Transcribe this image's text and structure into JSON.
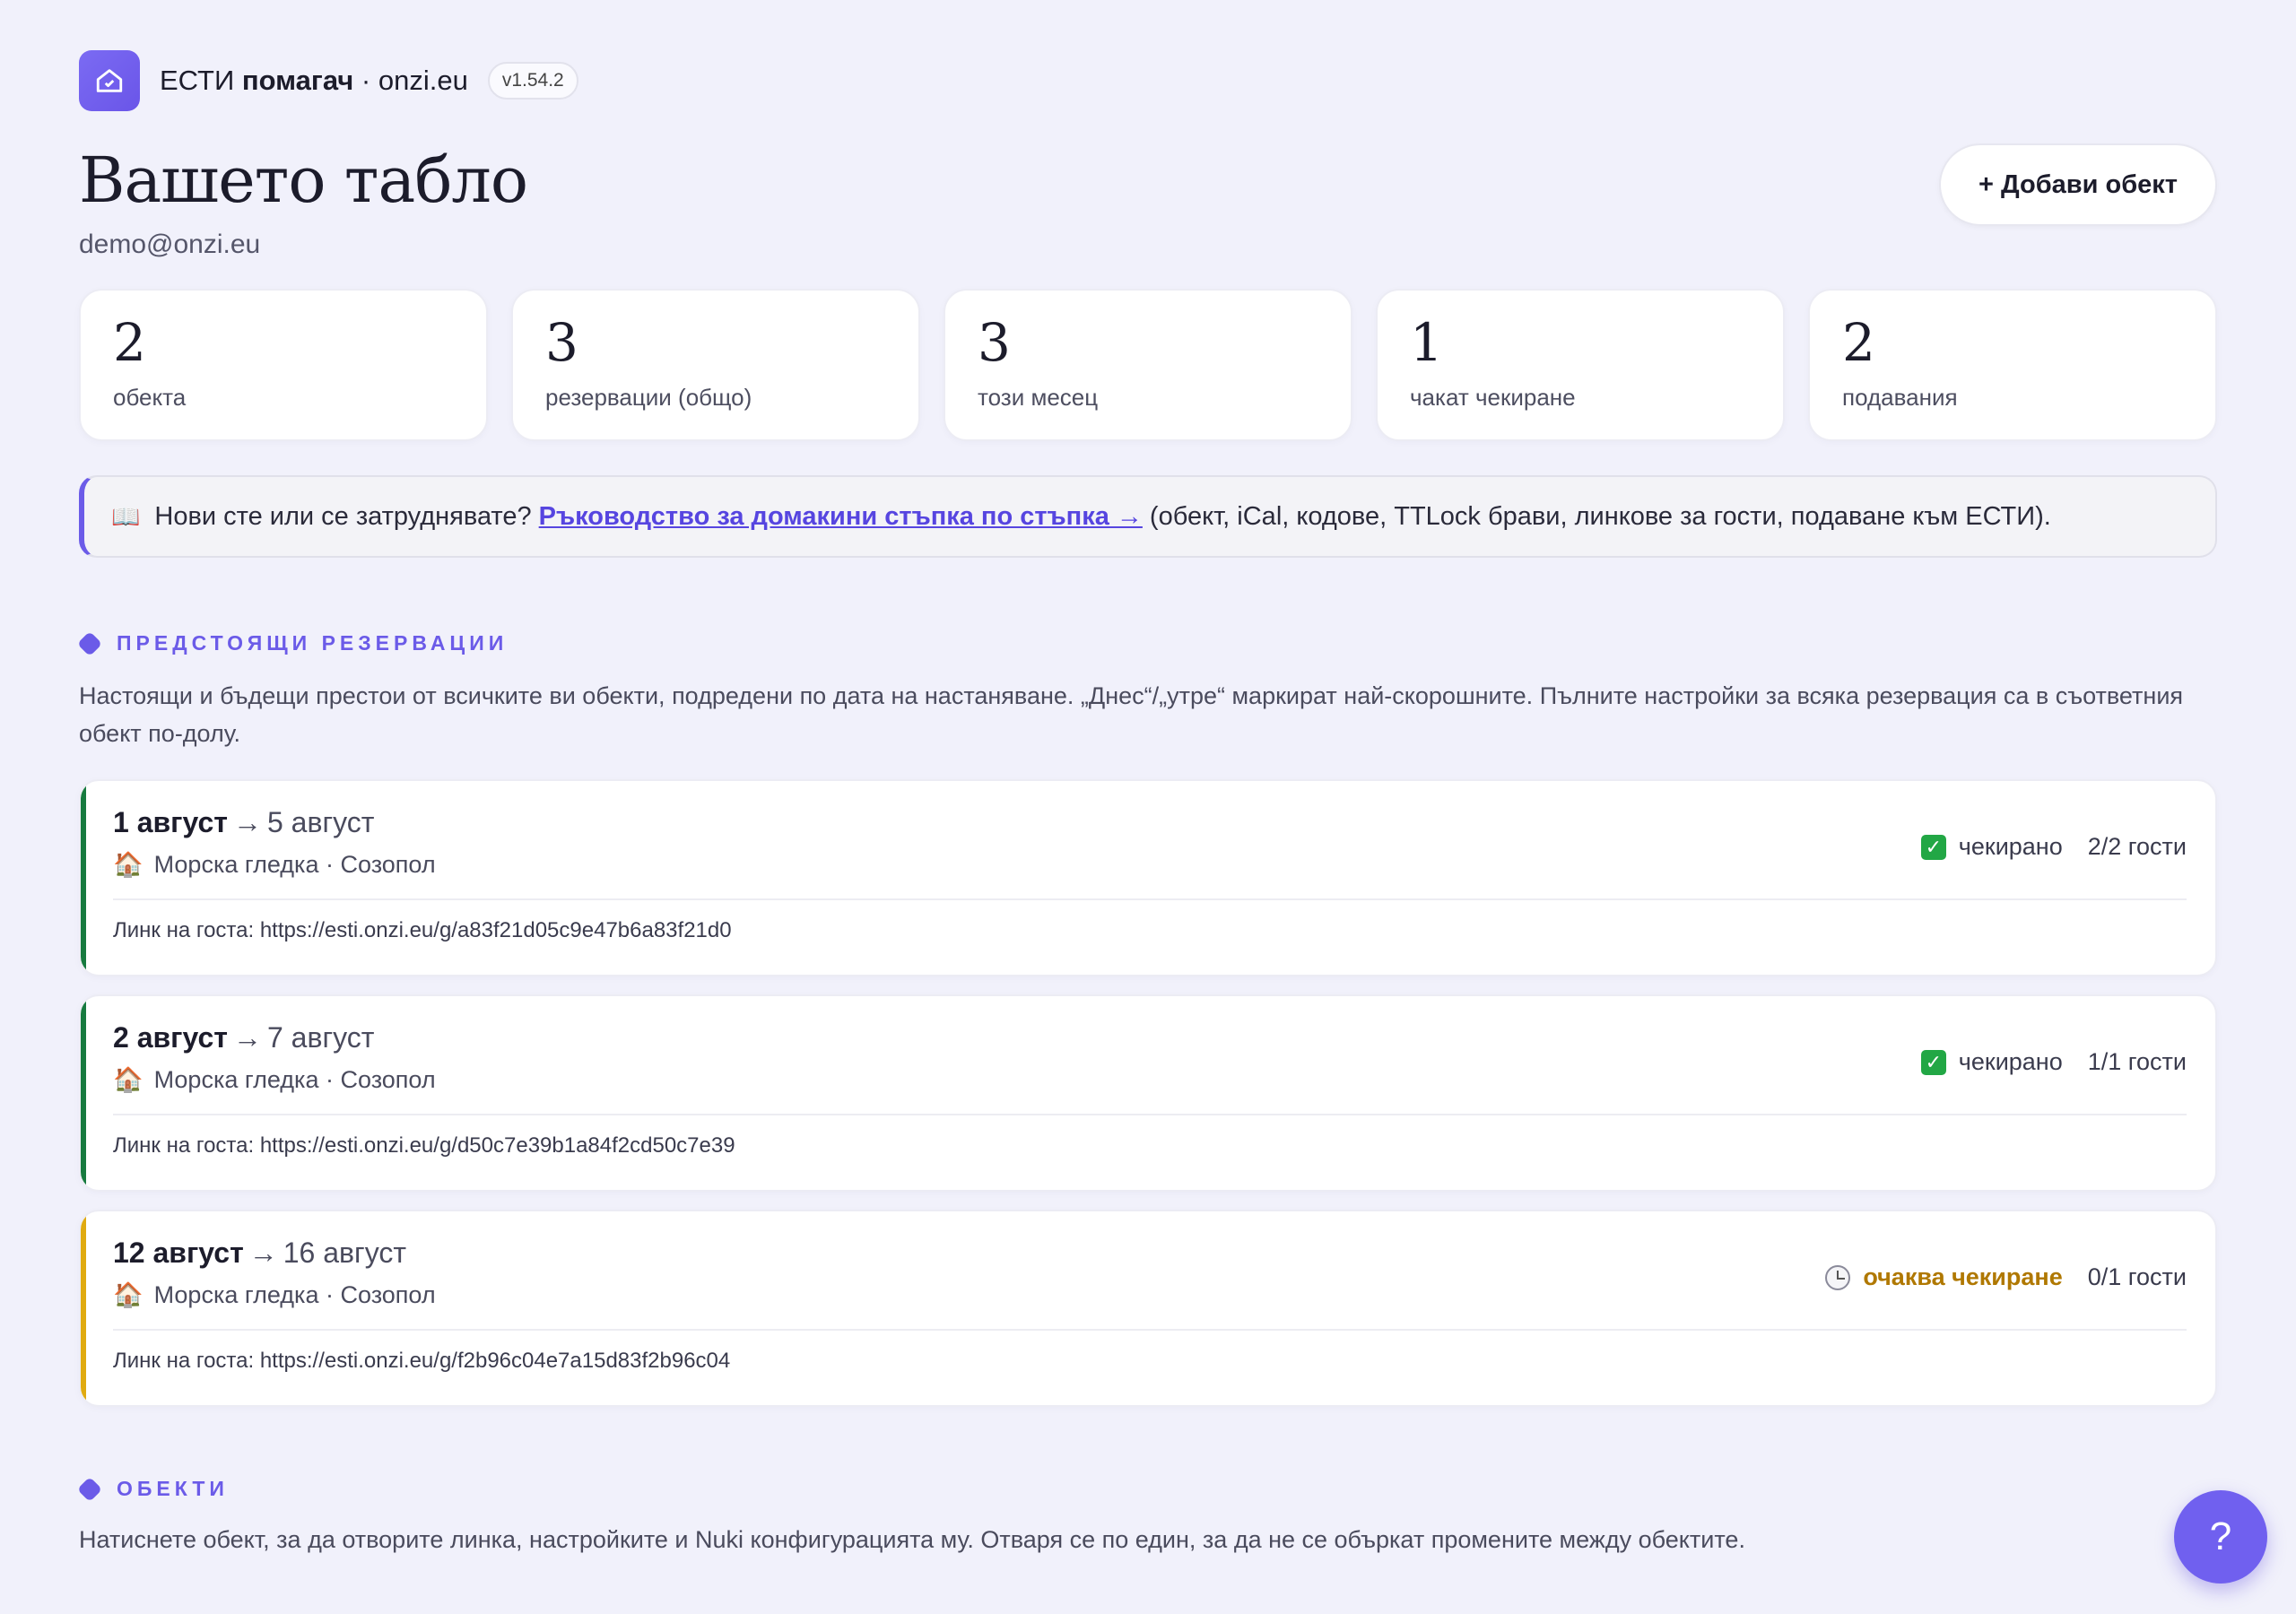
{
  "header": {
    "brand_prefix": "ЕСТИ",
    "brand_bold": "помагач",
    "brand_suffix": "· onzi.eu",
    "version": "v1.54.2",
    "accent": "#6b5be8"
  },
  "dashboard": {
    "title": "Вашето табло",
    "email": "demo@onzi.eu",
    "add_button": "+ Добави обект"
  },
  "stats": [
    {
      "value": "2",
      "label": "обекта"
    },
    {
      "value": "3",
      "label": "резервации (общо)"
    },
    {
      "value": "3",
      "label": "този месец"
    },
    {
      "value": "1",
      "label": "чакат чекиране"
    },
    {
      "value": "2",
      "label": "подавания"
    }
  ],
  "guide": {
    "icon": "book-icon",
    "prefix": "Нови сте или се затруднявате?",
    "link": "Ръководство за домакини стъпка по стъпка →",
    "suffix": "(обект, iCal, кодове, TTLock брави, линкове за гости, подаване към ЕСТИ)."
  },
  "upcoming": {
    "title": "ПРЕДСТОЯЩИ РЕЗЕРВАЦИИ",
    "description": "Настоящи и бъдещи престои от всичките ви обекти, подредени по дата на настаняване. „Днес“/„утре“ маркират най-скорошните. Пълните настройки за всяка резервация са в съответния обект по-долу.",
    "bookings": [
      {
        "start": "1 август",
        "end": "5 август",
        "property": "Морска гледка · Созопол",
        "status": "чекирано",
        "status_kind": "done",
        "guests": "2/2 гости",
        "link": "Линк на госта: https://esti.onzi.eu/g/a83f21d05c9e47b6a83f21d0",
        "bar_color": "#177a3f"
      },
      {
        "start": "2 август",
        "end": "7 август",
        "property": "Морска гледка · Созопол",
        "status": "чекирано",
        "status_kind": "done",
        "guests": "1/1 гости",
        "link": "Линк на госта: https://esti.onzi.eu/g/d50c7e39b1a84f2cd50c7e39",
        "bar_color": "#177a3f"
      },
      {
        "start": "12 август",
        "end": "16 август",
        "property": "Морска гледка · Созопол",
        "status": "очаква чекиране",
        "status_kind": "pending",
        "guests": "0/1 гости",
        "link": "Линк на госта: https://esti.onzi.eu/g/f2b96c04e7a15d83f2b96c04",
        "bar_color": "#e0aa10"
      }
    ]
  },
  "properties": {
    "title": "ОБЕКТИ",
    "description": "Натиснете обект, за да отворите линка, настройките и Nuki конфигурацията му. Отваря се по един, за да не се объркат промените между обектите."
  },
  "help": {
    "label": "?"
  }
}
